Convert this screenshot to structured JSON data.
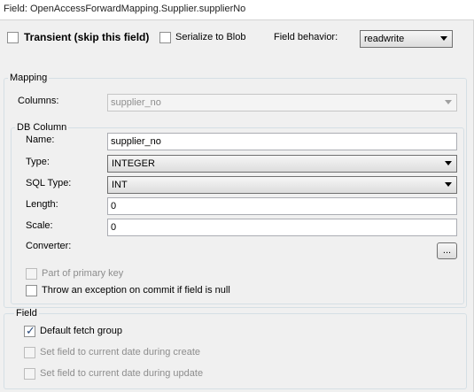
{
  "header": {
    "title": "Field: OpenAccessForwardMapping.Supplier.supplierNo"
  },
  "top": {
    "transient_label": "Transient (skip this field)",
    "transient_checked": false,
    "serialize_label": "Serialize to Blob",
    "serialize_checked": false,
    "field_behavior_label": "Field behavior:",
    "field_behavior_value": "readwrite"
  },
  "mapping": {
    "title": "Mapping",
    "columns_label": "Columns:",
    "columns_value": "supplier_no",
    "db_column": {
      "title": "DB Column",
      "name_label": "Name:",
      "name_value": "supplier_no",
      "type_label": "Type:",
      "type_value": "INTEGER",
      "sql_type_label": "SQL Type:",
      "sql_type_value": "INT",
      "length_label": "Length:",
      "length_value": "0",
      "scale_label": "Scale:",
      "scale_value": "0",
      "converter_label": "Converter:",
      "converter_button": "...",
      "primary_key_label": "Part of primary key",
      "primary_key_checked": false,
      "throw_null_label": "Throw an exception on commit if field is null",
      "throw_null_checked": false
    }
  },
  "field_group": {
    "title": "Field",
    "default_fetch_label": "Default fetch group",
    "default_fetch_checked": true,
    "set_create_label": "Set field to current date during create",
    "set_create_checked": false,
    "set_update_label": "Set field to current date during update",
    "set_update_checked": false
  },
  "check_glyph": "✓"
}
